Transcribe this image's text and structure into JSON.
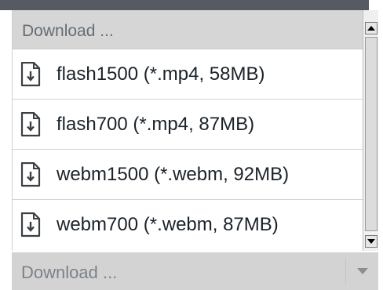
{
  "dropdown": {
    "header_label": "Download ...",
    "items": [
      {
        "label": "flash1500 (*.mp4, 58MB)",
        "icon": "file-download-icon"
      },
      {
        "label": "flash700 (*.mp4, 87MB)",
        "icon": "file-download-icon"
      },
      {
        "label": "webm1500 (*.webm, 92MB)",
        "icon": "file-download-icon"
      },
      {
        "label": "webm700 (*.webm, 87MB)",
        "icon": "file-download-icon"
      }
    ],
    "select_value": "Download ..."
  },
  "colors": {
    "accent_dark": "#555b60",
    "header_bg": "#d6d6d6",
    "icon_stroke": "#3b3f43"
  }
}
